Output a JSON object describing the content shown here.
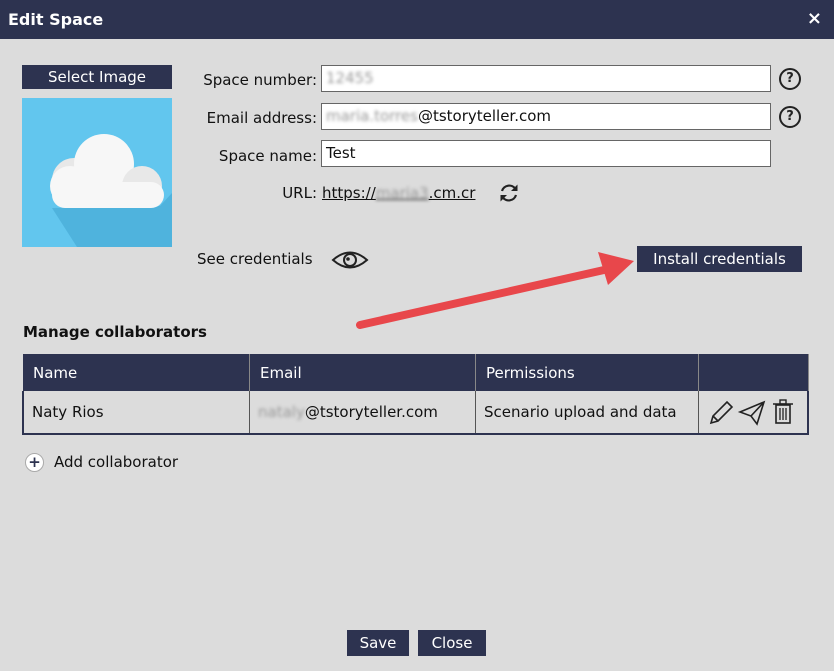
{
  "dialog": {
    "title": "Edit Space",
    "close_glyph": "×"
  },
  "image_panel": {
    "select_label": "Select Image",
    "icon": "cloud-icon"
  },
  "form": {
    "space_number_label": "Space number:",
    "space_number_value": "12455",
    "email_label": "Email address:",
    "email_blurred": "maria.torres",
    "email_domain": "@tstoryteller.com",
    "space_name_label": "Space name:",
    "space_name_value": "Test",
    "url_label": "URL:",
    "url_prefix": "https://",
    "url_blurred": "maria3",
    "url_suffix": ".cm.cr",
    "help_glyph": "?"
  },
  "credentials": {
    "see_label": "See credentials",
    "install_label": "Install credentials"
  },
  "collaborators": {
    "section_title": "Manage collaborators",
    "columns": [
      "Name",
      "Email",
      "Permissions",
      ""
    ],
    "rows": [
      {
        "name": "Naty Rios",
        "email_blurred": "nataly",
        "email_domain": "@tstoryteller.com",
        "permissions": "Scenario upload and data"
      }
    ],
    "add_label": "Add collaborator",
    "add_glyph": "+"
  },
  "footer": {
    "save_label": "Save",
    "close_label": "Close"
  },
  "colors": {
    "header": "#2d3350",
    "background": "#dcdcdc",
    "arrow": "#e8474b",
    "image_bg": "#62c6ee"
  }
}
